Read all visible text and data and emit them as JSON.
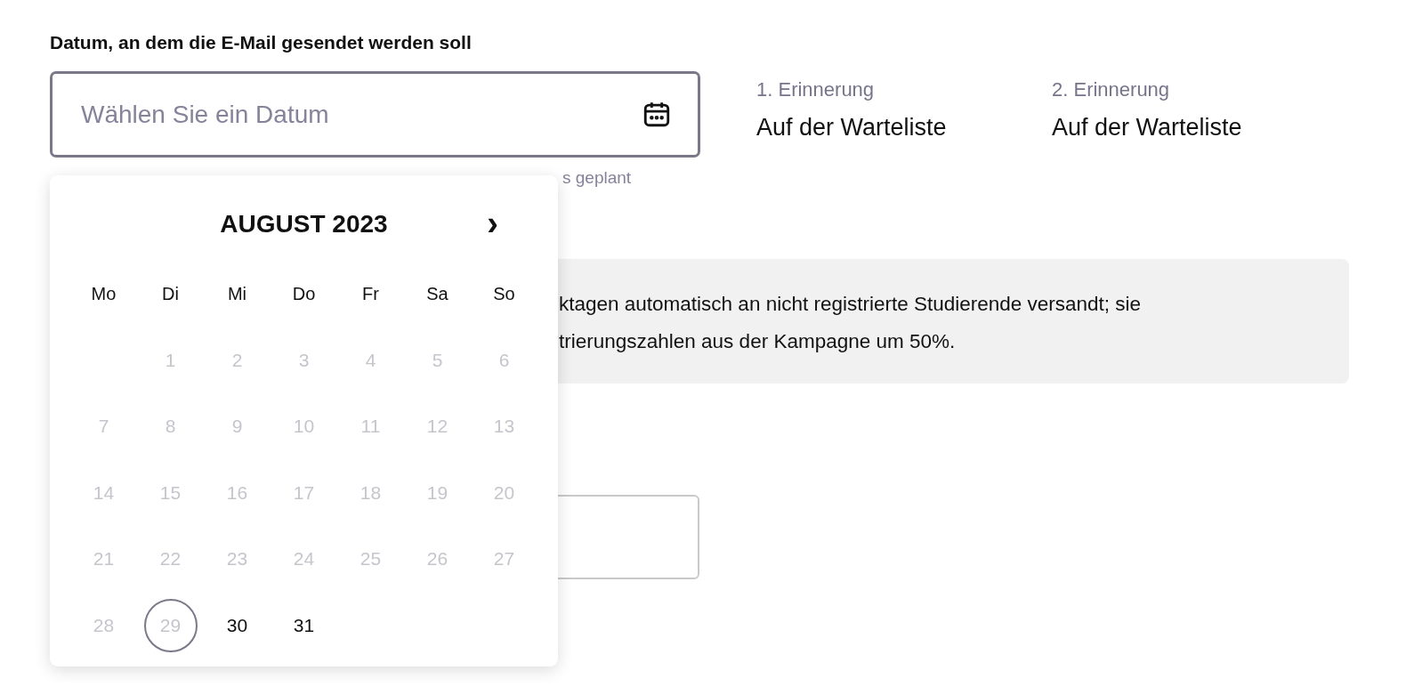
{
  "date_field": {
    "label": "Datum, an dem die E-Mail gesendet werden soll",
    "placeholder": "Wählen Sie ein Datum",
    "hint": "s geplant"
  },
  "reminders": [
    {
      "label": "1. Erinnerung",
      "value": "Auf der Warteliste"
    },
    {
      "label": "2. Erinnerung",
      "value": "Auf der Warteliste"
    }
  ],
  "info_box": {
    "lines": [
      "ktagen automatisch an nicht registrierte Studierende versandt; sie",
      "trierungszahlen aus der Kampagne um 50%."
    ]
  },
  "calendar": {
    "month": "AUGUST 2023",
    "next": "›",
    "weekdays": [
      "Mo",
      "Di",
      "Mi",
      "Do",
      "Fr",
      "Sa",
      "So"
    ],
    "weeks": [
      [
        {
          "day": "1",
          "disabled": true,
          "selected": false
        },
        {
          "day": "2",
          "disabled": true,
          "selected": false
        },
        {
          "day": "3",
          "disabled": true,
          "selected": false
        },
        {
          "day": "4",
          "disabled": true,
          "selected": false
        },
        {
          "day": "5",
          "disabled": true,
          "selected": false
        },
        {
          "day": "6",
          "disabled": true,
          "selected": false
        }
      ],
      [
        {
          "day": "7",
          "disabled": true,
          "selected": false
        },
        {
          "day": "8",
          "disabled": true,
          "selected": false
        },
        {
          "day": "9",
          "disabled": true,
          "selected": false
        },
        {
          "day": "10",
          "disabled": true,
          "selected": false
        },
        {
          "day": "11",
          "disabled": true,
          "selected": false
        },
        {
          "day": "12",
          "disabled": true,
          "selected": false
        },
        {
          "day": "13",
          "disabled": true,
          "selected": false
        }
      ],
      [
        {
          "day": "14",
          "disabled": true,
          "selected": false
        },
        {
          "day": "15",
          "disabled": true,
          "selected": false
        },
        {
          "day": "16",
          "disabled": true,
          "selected": false
        },
        {
          "day": "17",
          "disabled": true,
          "selected": false
        },
        {
          "day": "18",
          "disabled": true,
          "selected": false
        },
        {
          "day": "19",
          "disabled": true,
          "selected": false
        },
        {
          "day": "20",
          "disabled": true,
          "selected": false
        }
      ],
      [
        {
          "day": "21",
          "disabled": true,
          "selected": false
        },
        {
          "day": "22",
          "disabled": true,
          "selected": false
        },
        {
          "day": "23",
          "disabled": true,
          "selected": false
        },
        {
          "day": "24",
          "disabled": true,
          "selected": false
        },
        {
          "day": "25",
          "disabled": true,
          "selected": false
        },
        {
          "day": "26",
          "disabled": true,
          "selected": false
        },
        {
          "day": "27",
          "disabled": true,
          "selected": false
        }
      ],
      [
        {
          "day": "28",
          "disabled": true,
          "selected": false
        },
        {
          "day": "29",
          "disabled": true,
          "selected": true
        },
        {
          "day": "30",
          "disabled": false,
          "selected": false
        },
        {
          "day": "31",
          "disabled": false,
          "selected": false
        }
      ]
    ]
  }
}
